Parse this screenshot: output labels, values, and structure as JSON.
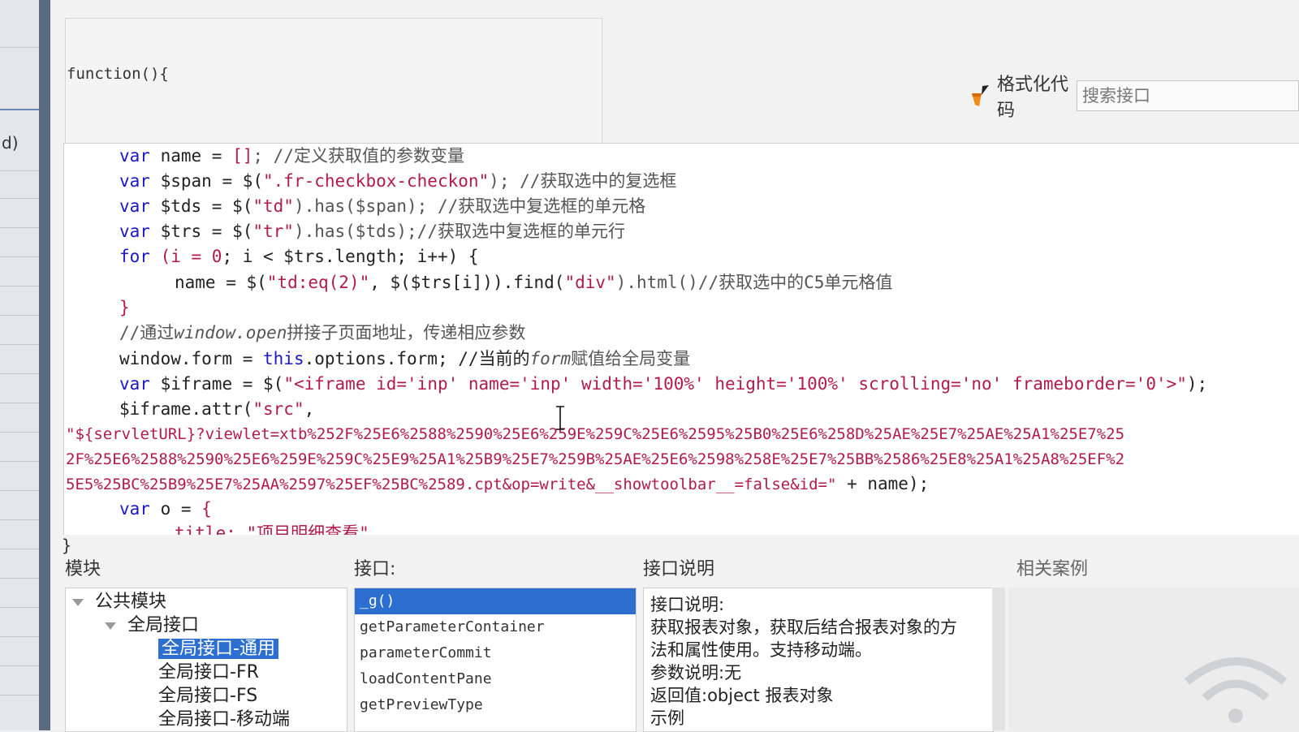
{
  "left_panel": {
    "partial_text": "d)"
  },
  "editor": {
    "function_open": "function(){",
    "function_close": "}",
    "format_code_label": "格式化代码",
    "search_placeholder": "搜索接口",
    "lines": [
      {
        "indent": 1,
        "tokens": [
          {
            "t": "var",
            "c": "kw"
          },
          {
            "t": " name = ",
            "c": "id"
          },
          {
            "t": "[]",
            "c": "pn"
          },
          {
            "t": "; //定义获取值的参数变量",
            "c": "cm"
          }
        ]
      },
      {
        "indent": 1,
        "tokens": [
          {
            "t": "var",
            "c": "kw"
          },
          {
            "t": " $span = $(",
            "c": "id"
          },
          {
            "t": "\".fr-checkbox-checkon\"",
            "c": "str"
          },
          {
            "t": "); //获取选中的复选框",
            "c": "cm"
          }
        ]
      },
      {
        "indent": 1,
        "tokens": [
          {
            "t": "var",
            "c": "kw"
          },
          {
            "t": " $tds = $(",
            "c": "id"
          },
          {
            "t": "\"td\"",
            "c": "str"
          },
          {
            "t": ").has($span); //获取选中复选框的单元格",
            "c": "cm"
          }
        ]
      },
      {
        "indent": 1,
        "tokens": [
          {
            "t": "var",
            "c": "kw"
          },
          {
            "t": " $trs = $(",
            "c": "id"
          },
          {
            "t": "\"tr\"",
            "c": "str"
          },
          {
            "t": ").has($tds);//获取选中复选框的单元行",
            "c": "cm"
          }
        ]
      },
      {
        "indent": 1,
        "tokens": [
          {
            "t": "for",
            "c": "kw"
          },
          {
            "t": " (i = ",
            "c": "pn"
          },
          {
            "t": "0",
            "c": "str"
          },
          {
            "t": "; i < $trs.length; i++) {",
            "c": "id"
          }
        ]
      },
      {
        "indent": 2,
        "tokens": [
          {
            "t": "name = $(",
            "c": "id"
          },
          {
            "t": "\"td:eq(2)\"",
            "c": "str"
          },
          {
            "t": ", $($trs[i])).find(",
            "c": "id"
          },
          {
            "t": "\"div\"",
            "c": "str"
          },
          {
            "t": ").html()//获取选中的C5单元格值",
            "c": "cm"
          }
        ]
      },
      {
        "indent": 1,
        "tokens": [
          {
            "t": "}",
            "c": "pn"
          }
        ]
      },
      {
        "indent": 1,
        "tokens": [
          {
            "t": "//通过",
            "c": "cm"
          },
          {
            "t": "window.open",
            "c": "cmi"
          },
          {
            "t": "拼接子页面地址，传递相应参数",
            "c": "cm"
          }
        ]
      },
      {
        "indent": 1,
        "tokens": [
          {
            "t": "window.form = ",
            "c": "id"
          },
          {
            "t": "this",
            "c": "kw"
          },
          {
            "t": ".options.form; //当前的",
            "c": "id"
          },
          {
            "t": "form",
            "c": "cmi"
          },
          {
            "t": "赋值给全局变量",
            "c": "cm"
          }
        ]
      },
      {
        "indent": 1,
        "tokens": [
          {
            "t": "var",
            "c": "kw"
          },
          {
            "t": " $iframe = $(",
            "c": "id"
          },
          {
            "t": "\"<iframe id='inp' name='inp' width='100%' height='100%' scrolling='no' frameborder='0'>\"",
            "c": "str"
          },
          {
            "t": ");",
            "c": "id"
          }
        ]
      },
      {
        "indent": 1,
        "tokens": [
          {
            "t": "$iframe.attr(",
            "c": "id"
          },
          {
            "t": "\"src\"",
            "c": "str"
          },
          {
            "t": ",",
            "c": "id"
          }
        ]
      },
      {
        "indent": 0,
        "tokens": [
          {
            "t": "\"${servletURL}?viewlet=xtb%252F%25E6%2588%2590%25E6%259E%259C%25E6%2595%25B0%25E6%258D%25AE%25E7%25AE%25A1%25E7%25",
            "c": "url"
          }
        ]
      },
      {
        "indent": 0,
        "tokens": [
          {
            "t": "2F%25E6%2588%2590%25E6%259E%259C%25E9%25A1%25B9%25E7%259B%25AE%25E6%2598%258E%25E7%25BB%2586%25E8%25A1%25A8%25EF%2",
            "c": "url"
          }
        ]
      },
      {
        "indent": 0,
        "tokens": [
          {
            "t": "5E5%25BC%25B9%25E7%25AA%2597%25EF%25BC%2589.cpt&op=write&__showtoolbar__=false&id=\"",
            "c": "url"
          },
          {
            "t": " + name);",
            "c": "id"
          }
        ]
      },
      {
        "indent": 1,
        "tokens": [
          {
            "t": "var",
            "c": "kw"
          },
          {
            "t": " o = ",
            "c": "id"
          },
          {
            "t": "{",
            "c": "pn"
          }
        ]
      },
      {
        "indent": 2,
        "tokens": [
          {
            "t": "title: \"项目明细查看\"",
            "c": "str"
          }
        ]
      }
    ]
  },
  "panels": {
    "module_header": "模块",
    "api_header": "接口:",
    "desc_header": "接口说明",
    "cases_header": "相关案例"
  },
  "module_tree": [
    {
      "label": "公共模块",
      "level": 0,
      "expanded": true,
      "selected": false
    },
    {
      "label": "全局接口",
      "level": 1,
      "expanded": true,
      "selected": false
    },
    {
      "label": "全局接口-通用",
      "level": 2,
      "expanded": false,
      "selected": true
    },
    {
      "label": "全局接口-FR",
      "level": 2,
      "expanded": false,
      "selected": false
    },
    {
      "label": "全局接口-FS",
      "level": 2,
      "expanded": false,
      "selected": false
    },
    {
      "label": "全局接口-移动端",
      "level": 2,
      "expanded": false,
      "selected": false
    }
  ],
  "api_list": [
    {
      "label": "_g()",
      "selected": true
    },
    {
      "label": "getParameterContainer",
      "selected": false
    },
    {
      "label": "parameterCommit",
      "selected": false
    },
    {
      "label": "loadContentPane",
      "selected": false
    },
    {
      "label": "getPreviewType",
      "selected": false
    }
  ],
  "description": {
    "lines": [
      "接口说明:",
      "获取报表对象，获取后结合报表对象的方",
      "法和属性使用。支持移动端。",
      "参数说明:无",
      "返回值:object 报表对象",
      "示例"
    ]
  },
  "colors": {
    "keyword": "#1b18c9",
    "string": "#b21a4e",
    "selection": "#2c6fd1"
  }
}
